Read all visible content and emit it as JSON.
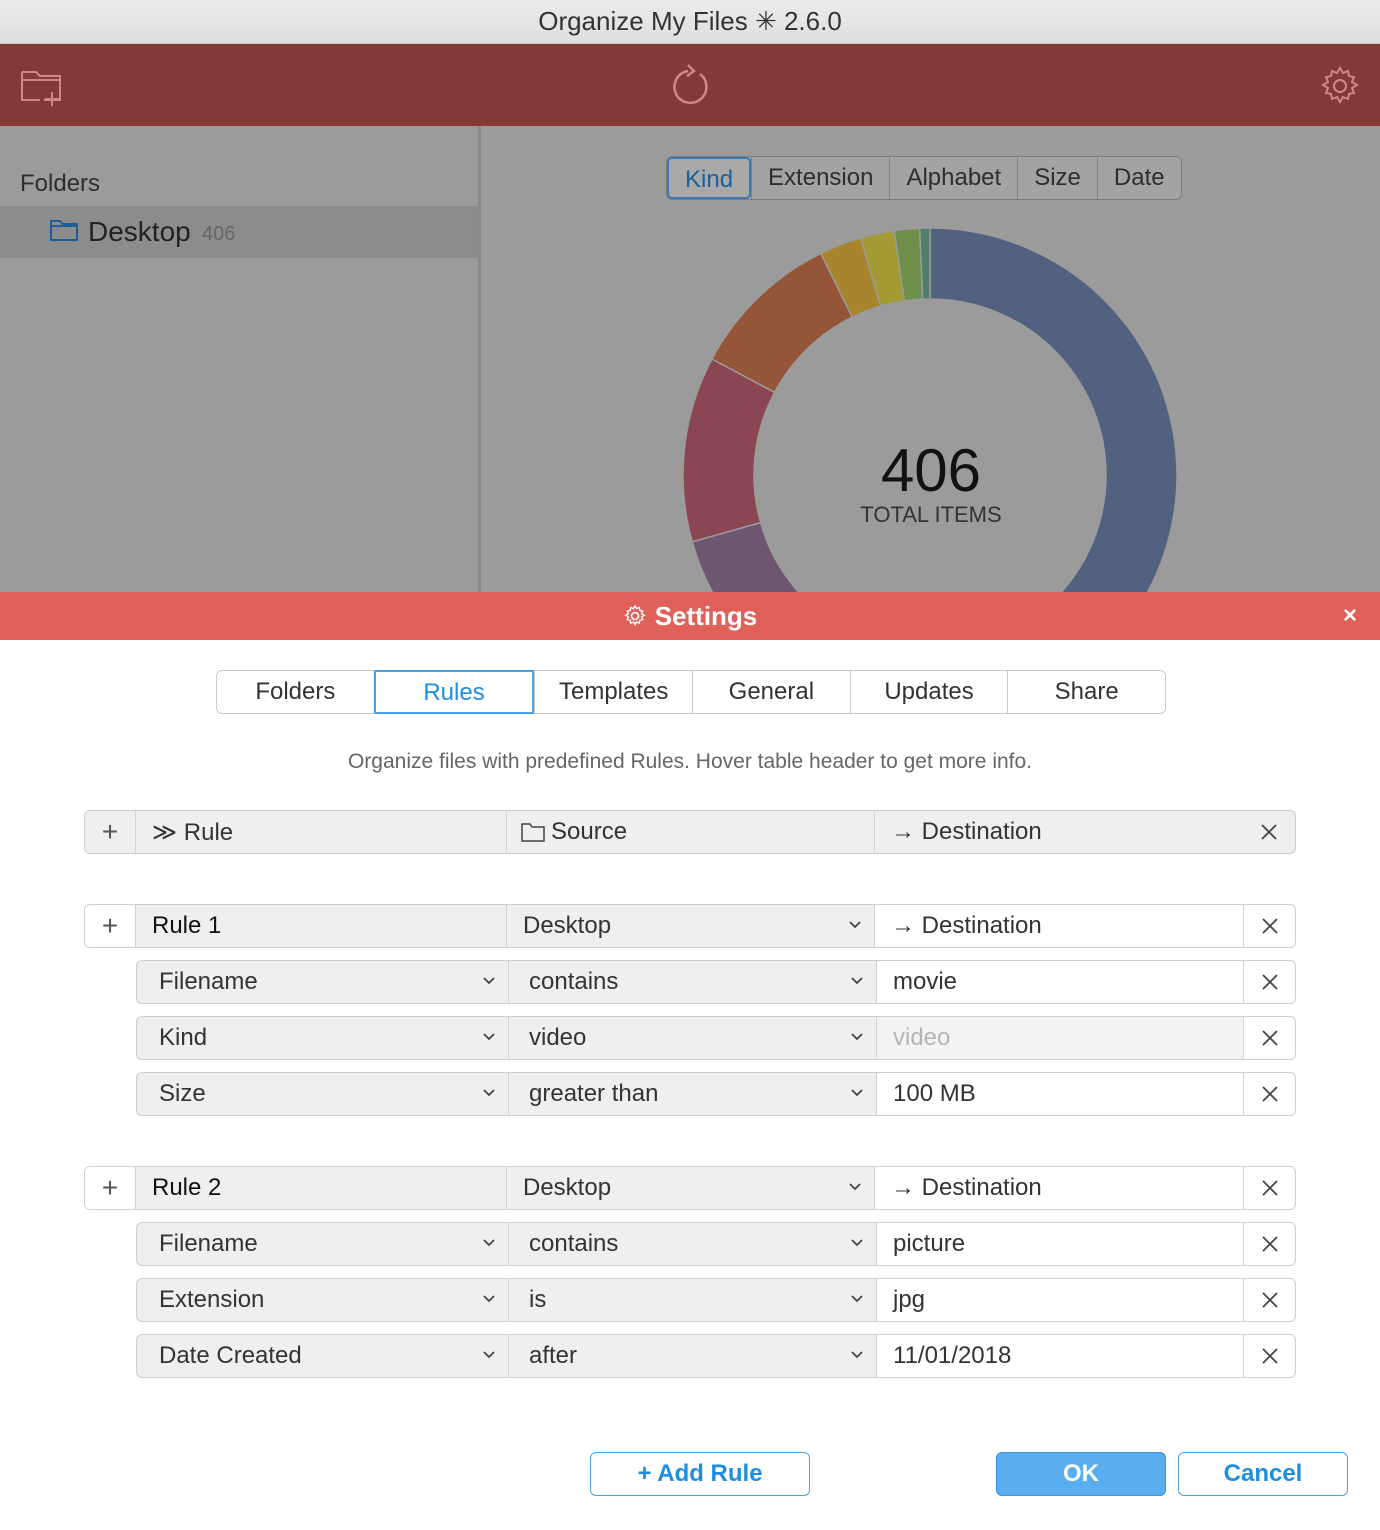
{
  "window": {
    "title": "Organize My Files ✳ 2.6.0"
  },
  "toolbar": {
    "new_folder_icon": "folder-plus-icon",
    "refresh_icon": "refresh-icon",
    "settings_icon": "gear-icon"
  },
  "sidebar": {
    "header": "Folders",
    "items": [
      {
        "name": "Desktop",
        "count": "406"
      }
    ]
  },
  "view_tabs": [
    "Kind",
    "Extension",
    "Alphabet",
    "Size",
    "Date"
  ],
  "chart_data": {
    "type": "pie",
    "center_value": "406",
    "center_label": "TOTAL ITEMS",
    "slices": [
      {
        "value": 52,
        "color": "#526180"
      },
      {
        "value": 12,
        "color": "#6e5570"
      },
      {
        "value": 11,
        "color": "#8b4653"
      },
      {
        "value": 9,
        "color": "#945538"
      },
      {
        "value": 2.5,
        "color": "#a8842c"
      },
      {
        "value": 2,
        "color": "#a39a33"
      },
      {
        "value": 1.5,
        "color": "#6e8f4a"
      },
      {
        "value": 0.6,
        "color": "#4f7f6a"
      }
    ]
  },
  "settings": {
    "title": "Settings",
    "close": "×",
    "tabs": [
      "Folders",
      "Rules",
      "Templates",
      "General",
      "Updates",
      "Share"
    ],
    "description": "Organize files with predefined Rules. Hover table header to get more info.",
    "header": {
      "plus": "+",
      "rule": "≫ Rule",
      "source": "Source",
      "destination": "→ Destination"
    },
    "rules": [
      {
        "name": "Rule 1",
        "source": "Desktop",
        "destination": "→ Destination",
        "conditions": [
          {
            "field": "Filename",
            "op": "contains",
            "value": "movie",
            "is_placeholder": false
          },
          {
            "field": "Kind",
            "op": "video",
            "value": "video",
            "is_placeholder": true
          },
          {
            "field": "Size",
            "op": "greater than",
            "value": "100 MB",
            "is_placeholder": false
          }
        ]
      },
      {
        "name": "Rule 2",
        "source": "Desktop",
        "destination": "→ Destination",
        "conditions": [
          {
            "field": "Filename",
            "op": "contains",
            "value": "picture",
            "is_placeholder": false
          },
          {
            "field": "Extension",
            "op": "is",
            "value": "jpg",
            "is_placeholder": false
          },
          {
            "field": "Date Created",
            "op": "after",
            "value": "11/01/2018",
            "is_placeholder": false
          }
        ]
      }
    ],
    "buttons": {
      "add_rule": "+ Add Rule",
      "ok": "OK",
      "cancel": "Cancel"
    }
  }
}
